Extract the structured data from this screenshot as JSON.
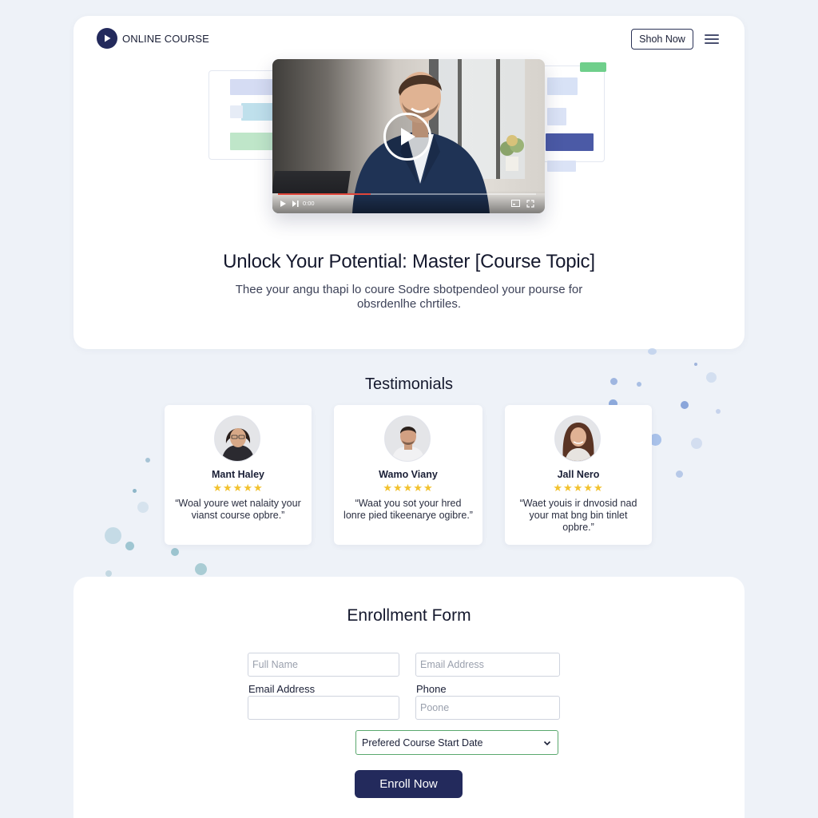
{
  "header": {
    "brand_name": "ONLINE COURSE",
    "brand_icon": "play-circle-icon",
    "shop_button": "Shoh Now",
    "menu_icon": "hamburger-menu-icon"
  },
  "video": {
    "play_icon": "play-icon",
    "time_text": "0:00",
    "progress": 0.36,
    "accent_color": "#e0463a"
  },
  "hero": {
    "title": "Unlock Your Potential: Master [Course Topic]",
    "subtitle": "Thee your angu thapi lo coure Sodre sbotpendeol your pourse for obsrdenlhe chrtiles."
  },
  "testimonials": {
    "title": "Testimonials",
    "items": [
      {
        "name": "Mant Haley",
        "stars": "★★★★★",
        "rating": 5,
        "quote": "“Woal youre wet nalaity your vianst course opbre.”"
      },
      {
        "name": "Wamo Viany",
        "stars": "★★★★★",
        "rating": 5,
        "quote": "“Waat you sot your hred lonre pied tikeenarye ogibre.”"
      },
      {
        "name": "Jall Nero",
        "stars": "★★★★★",
        "rating": 5,
        "quote": "“Waet youis ir dnvosid nad your mat bng bin tinlet opbre.”"
      }
    ]
  },
  "form": {
    "title": "Enrollment Form",
    "full_name_placeholder": "Full Name",
    "email_top_placeholder": "Email Address",
    "email_label": "Email Address",
    "phone_label": "Phone",
    "phone_placeholder": "Poone",
    "course_date_select": "Prefered Course Start Date",
    "enroll_button": "Enroll Now"
  },
  "colors": {
    "brand": "#232a5c",
    "background": "#eef2f8",
    "star": "#f2c22e",
    "select_border": "#5aa86e"
  }
}
